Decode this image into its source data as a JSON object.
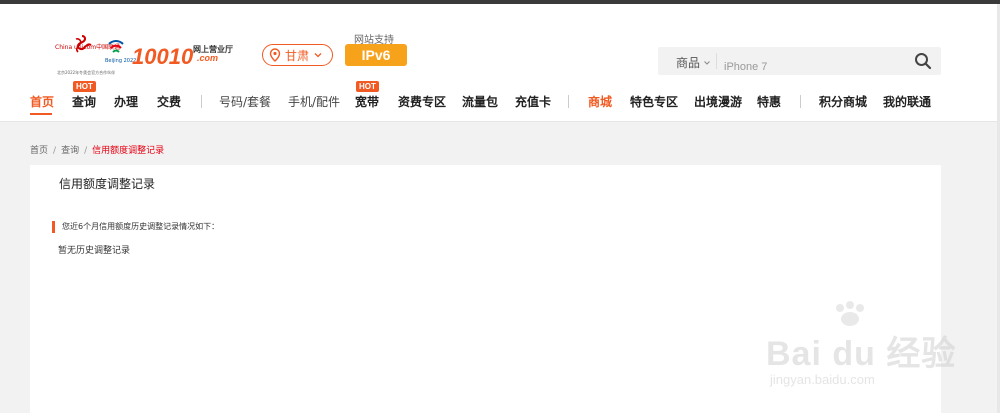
{
  "brand": {
    "cu_text": "China unicom中国联通",
    "bj_text": "Beijing 2022",
    "small_print": "北京2022年冬奥会官方合作伙伴",
    "number": "10010",
    "sub": "网上营业厅",
    "com": ".com"
  },
  "region": {
    "label": "甘肃"
  },
  "ipv6": {
    "label": "网站支持",
    "badge": "IPv6"
  },
  "search": {
    "category": "商品",
    "placeholder": "iPhone 7"
  },
  "nav": {
    "items": [
      {
        "label": "首页"
      },
      {
        "label": "查询",
        "badge": "HOT"
      },
      {
        "label": "办理"
      },
      {
        "label": "交费"
      },
      {
        "label": "号码/套餐"
      },
      {
        "label": "手机/配件"
      },
      {
        "label": "宽带",
        "badge": "HOT"
      },
      {
        "label": "资费专区"
      },
      {
        "label": "流量包"
      },
      {
        "label": "充值卡"
      },
      {
        "label": "商城"
      },
      {
        "label": "特色专区"
      },
      {
        "label": "出境漫游"
      },
      {
        "label": "特惠"
      },
      {
        "label": "积分商城"
      },
      {
        "label": "我的联通"
      }
    ]
  },
  "breadcrumb": {
    "items": [
      "首页",
      "查询",
      "信用额度调整记录"
    ]
  },
  "page": {
    "title": "信用额度调整记录",
    "notice": "您近6个月信用额度历史调整记录情况如下：",
    "empty": "暂无历史调整记录"
  },
  "watermark": {
    "text": "Bai du 经验",
    "sub": "jingyan.baidu.com"
  },
  "colors": {
    "accent": "#f15a22",
    "ipv6": "#f7a21b",
    "current": "#e60012"
  }
}
